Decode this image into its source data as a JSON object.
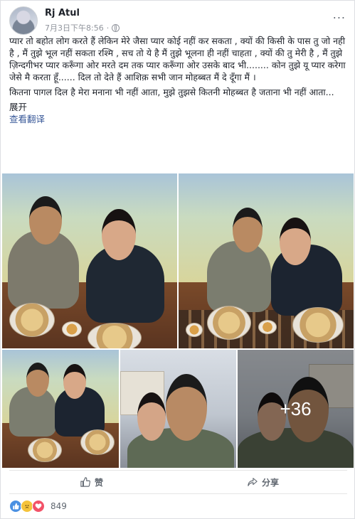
{
  "post": {
    "author": "Rj Atul",
    "timestamp": "7月3日下午8:56",
    "more_label": "...",
    "paragraph1": "प्यार तो बहोत लोग करते हैं लेकिन मेरे जैसा प्यार कोई नहीं कर सकता , क्यों की किसी के पास तु जो नही है , मैं तुझे भूल नहीं सकता रश्मि , सच तो ये है मैं तुझे भूलना ही नहीं चाहता , क्यों की तु मेरी है , मैं तुझे ज़िन्दगीभर प्यार करूँगा ओर मरते दम तक प्यार करूँगा ओर उसके बाद भी........ कोन तुझे यू प्यार करेगा जेसे मै करता हूँ...... दिल तो देते हैं आशिक़ सभी जान मोहब्बत मैं दे दूँगा मैं ।",
    "paragraph2": "कितना पागल दिल है मेरा मनाना भी नहीं आता, मुझे तुझसे कितनी मोहब्बत है जताना भी नहीं आता...",
    "see_more": "展开",
    "translate": "查看翻译"
  },
  "photos": {
    "extra_count": "+36"
  },
  "actions": {
    "like": "赞",
    "share": "分享"
  },
  "reactions": {
    "count": "849",
    "icons": [
      "like-icon",
      "sad-icon",
      "love-icon"
    ]
  },
  "colors": {
    "link": "#385898",
    "secondary_text": "#90949c"
  }
}
